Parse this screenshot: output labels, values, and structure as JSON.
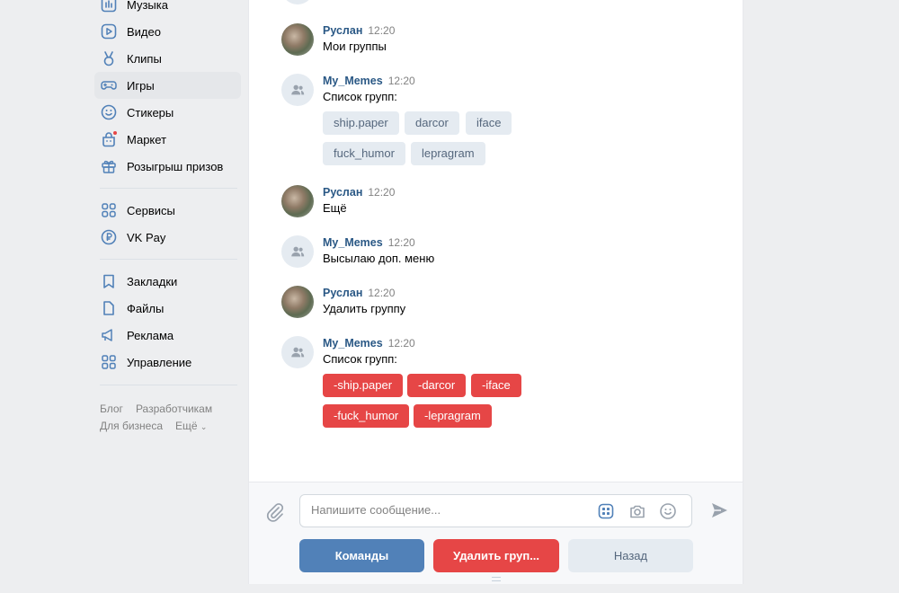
{
  "sidebar": {
    "items": [
      {
        "label": "Музыка",
        "icon": "music-icon"
      },
      {
        "label": "Видео",
        "icon": "video-icon"
      },
      {
        "label": "Клипы",
        "icon": "clips-icon"
      },
      {
        "label": "Игры",
        "icon": "gamepad-icon"
      },
      {
        "label": "Стикеры",
        "icon": "smile-icon"
      },
      {
        "label": "Маркет",
        "icon": "market-icon"
      },
      {
        "label": "Розыгрыш призов",
        "icon": "gift-icon"
      },
      {
        "label": "Сервисы",
        "icon": "services-icon"
      },
      {
        "label": "VK Pay",
        "icon": "ruble-icon"
      },
      {
        "label": "Закладки",
        "icon": "bookmark-icon"
      },
      {
        "label": "Файлы",
        "icon": "file-icon"
      },
      {
        "label": "Реклама",
        "icon": "megaphone-icon"
      },
      {
        "label": "Управление",
        "icon": "grid-icon"
      }
    ],
    "footer": {
      "blog": "Блог",
      "developers": "Разработчикам",
      "business": "Для бизнеса",
      "more": "Ещё"
    }
  },
  "messages": [
    {
      "author": "Руслан",
      "time": "12:20",
      "text": "Мои группы"
    },
    {
      "author": "My_Memes",
      "time": "12:20",
      "text": "Список групп:",
      "buttons": [
        "ship.paper",
        "darcor",
        "iface",
        "fuck_humor",
        "lepragram"
      ]
    },
    {
      "author": "Руслан",
      "time": "12:20",
      "text": "Ещё"
    },
    {
      "author": "My_Memes",
      "time": "12:20",
      "text": "Высылаю доп. меню"
    },
    {
      "author": "Руслан",
      "time": "12:20",
      "text": "Удалить группу"
    },
    {
      "author": "My_Memes",
      "time": "12:20",
      "text": "Список групп:",
      "buttons": [
        "-ship.paper",
        "-darcor",
        "-iface",
        "-fuck_humor",
        "-lepragram"
      ]
    }
  ],
  "composer": {
    "placeholder": "Напишите сообщение...",
    "buttons": {
      "commands": "Команды",
      "delete_group": "Удалить груп...",
      "back": "Назад"
    }
  },
  "colors": {
    "accent_blue": "#5181b8",
    "link_blue": "#2a5885",
    "danger_red": "#e64646",
    "keyboard_gray": "#e5ebf1"
  }
}
